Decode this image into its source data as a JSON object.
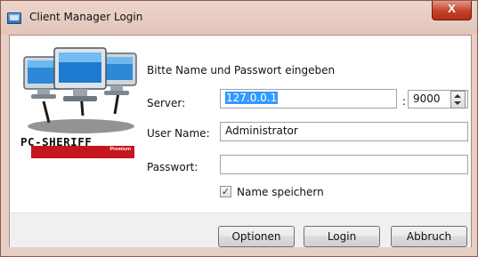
{
  "window": {
    "title": "Client Manager Login",
    "close_glyph": "X"
  },
  "logo": {
    "brand": "PC-SHERIFF",
    "edition": "Premium"
  },
  "form": {
    "prompt": "Bitte Name und Passwort eingeben",
    "server_label": "Server:",
    "server_value": "127.0.0.1",
    "port_separator": ":",
    "port_value": "9000",
    "username_label": "User Name:",
    "username_value": "Administrator",
    "password_label": "Passwort:",
    "password_value": "",
    "remember_label": "Name speichern",
    "remember_checked": true,
    "remember_glyph": "✓"
  },
  "buttons": {
    "options": "Optionen",
    "login": "Login",
    "cancel": "Abbruch"
  }
}
